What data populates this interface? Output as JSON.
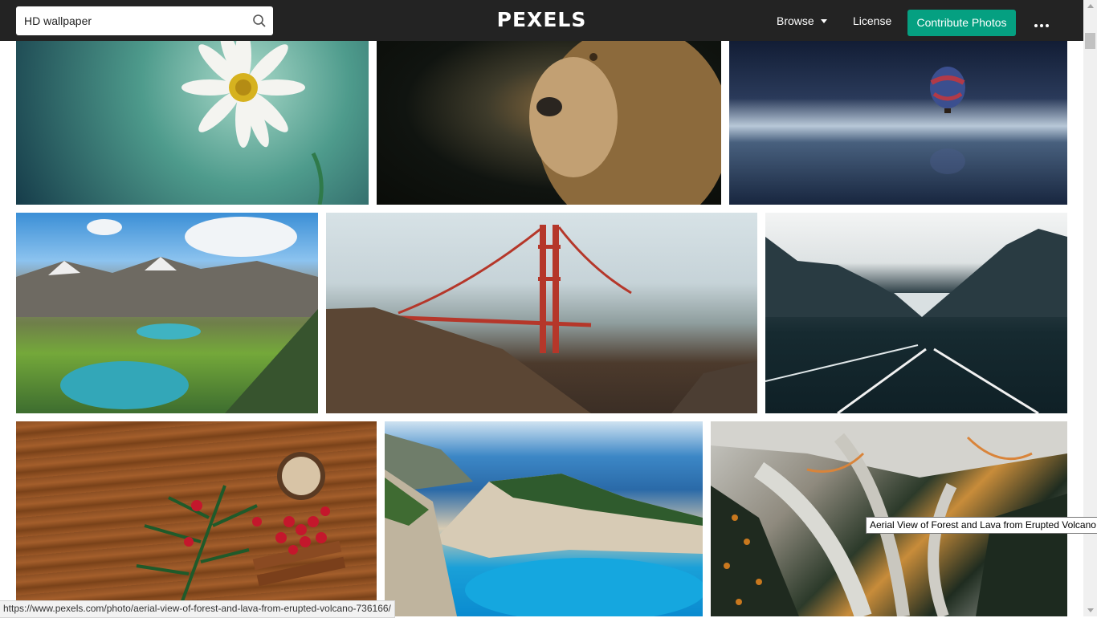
{
  "header": {
    "search": {
      "value": "HD wallpaper",
      "icon": "search-icon"
    },
    "logo": "PEXELS",
    "nav": {
      "browse_label": "Browse",
      "license_label": "License"
    },
    "contribute_label": "Contribute Photos",
    "colors": {
      "bar": "#232323",
      "accent": "#05a081"
    }
  },
  "photos": [
    {
      "alt": "White daisy on teal background"
    },
    {
      "alt": "Lion portrait on dark background"
    },
    {
      "alt": "Hot air balloon over calm water at night"
    },
    {
      "alt": "Alpine lake and mountains"
    },
    {
      "alt": "Golden Gate Bridge in fog"
    },
    {
      "alt": "Road into misty mountains"
    },
    {
      "alt": "Christmas decoration on wood"
    },
    {
      "alt": "Navagio beach cove"
    },
    {
      "alt": "Aerial view of forest and lava"
    }
  ],
  "tooltip": "Aerial View of Forest and Lava from Erupted Volcano",
  "status_url": "https://www.pexels.com/photo/aerial-view-of-forest-and-lava-from-erupted-volcano-736166/"
}
